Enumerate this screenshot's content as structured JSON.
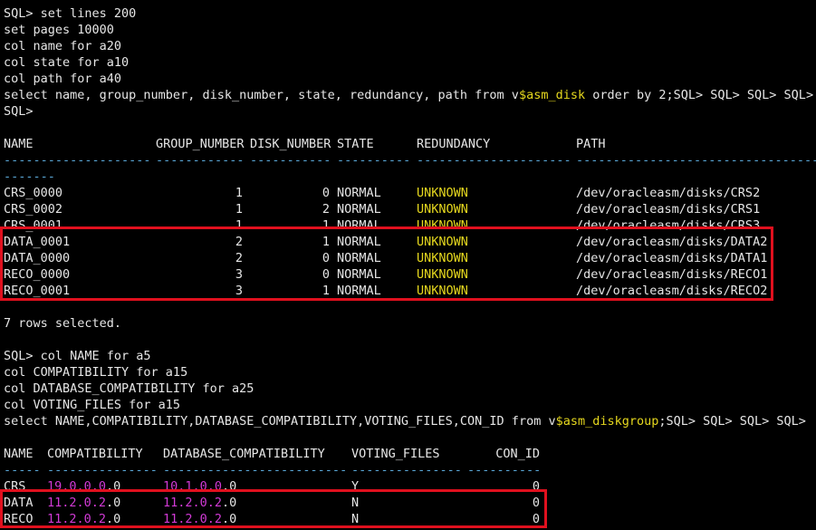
{
  "colors": {
    "background": "#000000",
    "text": "#e6e6e6",
    "keyword": "#e6d81e",
    "dollar_text": "#e6d81e",
    "version": "#d23ad6",
    "dashes": "#5aa8d8",
    "highlight": "#e0101e"
  },
  "session1": {
    "commands": [
      "SQL> set lines 200",
      "set pages 10000",
      "col name for a20",
      "col state for a10",
      "col path for a40"
    ],
    "select_pre": "select name, group_number, disk_number, state, redundancy, path from v",
    "select_dollar": "$asm_disk",
    "select_post": " order by 2;SQL> SQL> SQL> SQL> S",
    "prompt_tail": "SQL>",
    "headers": {
      "name": "NAME",
      "group_number": "GROUP_NUMBER",
      "disk_number": "DISK_NUMBER",
      "state": "STATE",
      "redundancy": "REDUNDANCY",
      "path": "PATH"
    },
    "dashes": {
      "name": "--------------------",
      "group_number": "------------",
      "disk_number": "-----------",
      "state": "----------",
      "redundancy": "---------------------",
      "path": "----------------------------------------------------------------",
      "wrap": "-------"
    },
    "rows": [
      {
        "name": "CRS_0000",
        "group_number": "1",
        "disk_number": "0",
        "state": "NORMAL",
        "redundancy": "UNKNOWN",
        "path": "/dev/oracleasm/disks/CRS2"
      },
      {
        "name": "CRS_0002",
        "group_number": "1",
        "disk_number": "2",
        "state": "NORMAL",
        "redundancy": "UNKNOWN",
        "path": "/dev/oracleasm/disks/CRS1"
      },
      {
        "name": "CRS_0001",
        "group_number": "1",
        "disk_number": "1",
        "state": "NORMAL",
        "redundancy": "UNKNOWN",
        "path": "/dev/oracleasm/disks/CRS3"
      },
      {
        "name": "DATA_0001",
        "group_number": "2",
        "disk_number": "1",
        "state": "NORMAL",
        "redundancy": "UNKNOWN",
        "path": "/dev/oracleasm/disks/DATA2"
      },
      {
        "name": "DATA_0000",
        "group_number": "2",
        "disk_number": "0",
        "state": "NORMAL",
        "redundancy": "UNKNOWN",
        "path": "/dev/oracleasm/disks/DATA1"
      },
      {
        "name": "RECO_0000",
        "group_number": "3",
        "disk_number": "0",
        "state": "NORMAL",
        "redundancy": "UNKNOWN",
        "path": "/dev/oracleasm/disks/RECO1"
      },
      {
        "name": "RECO_0001",
        "group_number": "3",
        "disk_number": "1",
        "state": "NORMAL",
        "redundancy": "UNKNOWN",
        "path": "/dev/oracleasm/disks/RECO2"
      }
    ],
    "rows_selected": "7 rows selected."
  },
  "session2": {
    "commands": [
      "SQL> col NAME for a5",
      "col COMPATIBILITY for a15",
      "col DATABASE_COMPATIBILITY for a25",
      "col VOTING_FILES for a15"
    ],
    "select_pre": "select NAME,COMPATIBILITY,DATABASE_COMPATIBILITY,VOTING_FILES,CON_ID from v",
    "select_dollar": "$asm_diskgroup",
    "select_post": ";SQL> SQL> SQL> SQL>",
    "headers": {
      "name": "NAME",
      "compatibility": "COMPATIBILITY",
      "database_compatibility": "DATABASE_COMPATIBILITY",
      "voting_files": "VOTING_FILES",
      "con_id": "CON_ID"
    },
    "dashes": {
      "name": "-----",
      "compatibility": "---------------",
      "database_compatibility": "-------------------------",
      "voting_files": "---------------",
      "con_id": "----------"
    },
    "rows": [
      {
        "name": "CRS",
        "compatibility": "19.0.0.0.0",
        "database_compatibility": "10.1.0.0.0",
        "voting_files": "Y",
        "con_id": "0"
      },
      {
        "name": "DATA",
        "compatibility": "11.2.0.2.0",
        "database_compatibility": "11.2.0.2.0",
        "voting_files": "N",
        "con_id": "0"
      },
      {
        "name": "RECO",
        "compatibility": "11.2.0.2.0",
        "database_compatibility": "11.2.0.2.0",
        "voting_files": "N",
        "con_id": "0"
      }
    ]
  }
}
